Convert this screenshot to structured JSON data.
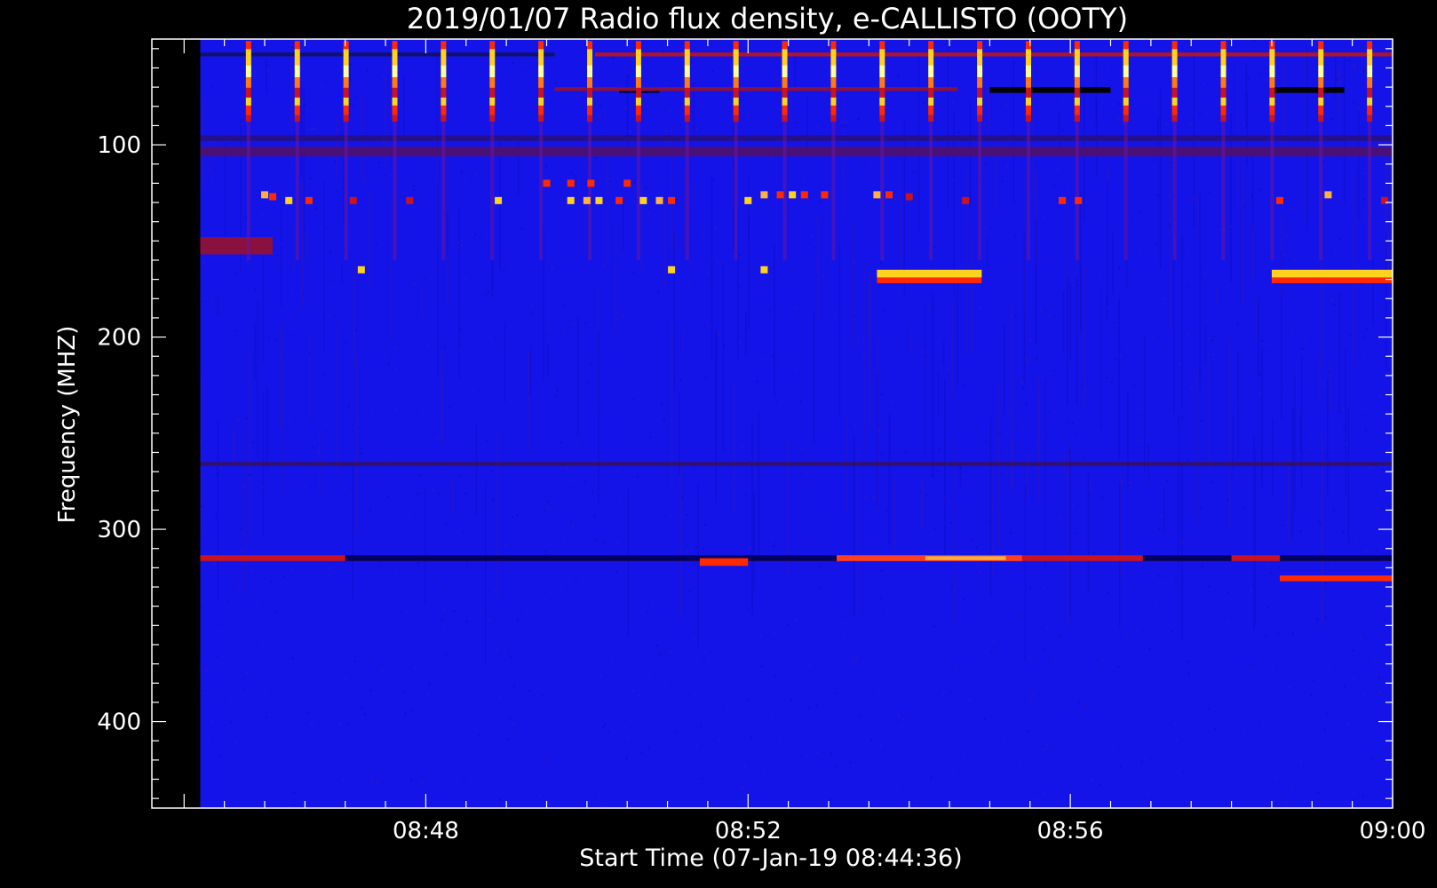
{
  "chart_data": {
    "type": "heatmap",
    "title": "2019/01/07  Radio flux density, e-CALLISTO (OOTY)",
    "xlabel": "Start Time (07-Jan-19 08:44:36)",
    "ylabel": "Frequency (MHZ)",
    "x_start": "08:44:36",
    "x_end": "09:00:00",
    "xlim_minutes": [
      0,
      15.4
    ],
    "ylim": [
      445,
      45
    ],
    "y_tick_values": [
      100,
      200,
      300,
      400
    ],
    "y_tick_labels": [
      "100",
      "200",
      "300",
      "400"
    ],
    "x_ticks": [
      {
        "label": "08:48",
        "minute": 3.4
      },
      {
        "label": "08:52",
        "minute": 7.4
      },
      {
        "label": "08:56",
        "minute": 11.4
      },
      {
        "label": "09:00",
        "minute": 15.4
      }
    ],
    "data_extent": {
      "x_minutes": [
        0.6,
        15.4
      ],
      "freq_mhz": [
        45,
        445
      ]
    },
    "colormap": [
      "#000000",
      "#1414e8",
      "#c8141e",
      "#ff2a00",
      "#ffd21e",
      "#ffff96"
    ],
    "background_color": "#1414e8",
    "periodic_bursts": {
      "start_min": 1.2,
      "period_min": 0.605,
      "count": 25,
      "freq_range": [
        46,
        88
      ]
    },
    "features": [
      {
        "kind": "band",
        "t0": 0.6,
        "t1": 15.4,
        "f0": 313.5,
        "f1": 316.5,
        "color": "#c8141e"
      },
      {
        "kind": "band",
        "t0": 2.4,
        "t1": 8.5,
        "f0": 313.5,
        "f1": 316.5,
        "color": "#000060"
      },
      {
        "kind": "band",
        "t0": 6.8,
        "t1": 7.4,
        "f0": 315,
        "f1": 319,
        "color": "#ff2a00"
      },
      {
        "kind": "band",
        "t0": 8.5,
        "t1": 10.8,
        "f0": 313.5,
        "f1": 316.5,
        "color": "#ff4020"
      },
      {
        "kind": "band",
        "t0": 9.6,
        "t1": 10.6,
        "f0": 314,
        "f1": 316,
        "color": "#ffb040"
      },
      {
        "kind": "band",
        "t0": 12.3,
        "t1": 13.4,
        "f0": 313.5,
        "f1": 316.5,
        "color": "#000060"
      },
      {
        "kind": "band",
        "t0": 14.0,
        "t1": 15.4,
        "f0": 313.5,
        "f1": 316.5,
        "color": "#000060"
      },
      {
        "kind": "band",
        "t0": 14.0,
        "t1": 15.4,
        "f0": 324,
        "f1": 327,
        "color": "#ff2a00"
      },
      {
        "kind": "band",
        "t0": 9.0,
        "t1": 10.3,
        "f0": 165,
        "f1": 169,
        "color": "#ffd21e"
      },
      {
        "kind": "band",
        "t0": 9.0,
        "t1": 10.3,
        "f0": 169,
        "f1": 172,
        "color": "#ff2a00"
      },
      {
        "kind": "band",
        "t0": 13.9,
        "t1": 15.4,
        "f0": 165,
        "f1": 169,
        "color": "#ffd21e"
      },
      {
        "kind": "band",
        "t0": 13.9,
        "t1": 15.4,
        "f0": 169,
        "f1": 172,
        "color": "#ff2a00"
      },
      {
        "kind": "band",
        "t0": 10.4,
        "t1": 11.9,
        "f0": 70,
        "f1": 73,
        "color": "#000000"
      },
      {
        "kind": "band",
        "t0": 13.9,
        "t1": 14.8,
        "f0": 70,
        "f1": 73,
        "color": "#000000"
      },
      {
        "kind": "band",
        "t0": 5.8,
        "t1": 6.3,
        "f0": 70,
        "f1": 73,
        "color": "#000030"
      },
      {
        "kind": "band",
        "t0": 5.0,
        "t1": 10.0,
        "f0": 70,
        "f1": 72,
        "color": "#8a1040"
      },
      {
        "kind": "band",
        "t0": 5.5,
        "t1": 15.4,
        "f0": 52,
        "f1": 54,
        "color": "#b01428"
      },
      {
        "kind": "band",
        "t0": 0.6,
        "t1": 5.0,
        "f0": 52,
        "f1": 54,
        "color": "#101070"
      },
      {
        "kind": "band",
        "t0": 0.6,
        "t1": 15.4,
        "f0": 95,
        "f1": 98,
        "color": "#26108a"
      },
      {
        "kind": "band",
        "t0": 0.6,
        "t1": 15.4,
        "f0": 101,
        "f1": 106,
        "color": "#4a1078"
      },
      {
        "kind": "band",
        "t0": 0.6,
        "t1": 1.5,
        "f0": 148,
        "f1": 157,
        "color": "#8a1040"
      },
      {
        "kind": "band",
        "t0": 0.6,
        "t1": 15.4,
        "f0": 265,
        "f1": 267,
        "color": "#30106a"
      }
    ],
    "dots": [
      {
        "t": 1.4,
        "f": 126,
        "color": "#ffb040"
      },
      {
        "t": 1.5,
        "f": 127,
        "color": "#ff2a00"
      },
      {
        "t": 1.7,
        "f": 129,
        "color": "#ffd21e"
      },
      {
        "t": 1.95,
        "f": 129,
        "color": "#ff2a00"
      },
      {
        "t": 2.5,
        "f": 129,
        "color": "#c8141e"
      },
      {
        "t": 3.2,
        "f": 129,
        "color": "#c8141e"
      },
      {
        "t": 4.3,
        "f": 129,
        "color": "#ffd21e"
      },
      {
        "t": 4.9,
        "f": 120,
        "color": "#ff2a00"
      },
      {
        "t": 5.2,
        "f": 120,
        "color": "#ff2a00"
      },
      {
        "t": 5.45,
        "f": 120,
        "color": "#ff2a00"
      },
      {
        "t": 5.9,
        "f": 120,
        "color": "#ff2a00"
      },
      {
        "t": 5.2,
        "f": 129,
        "color": "#ffd21e"
      },
      {
        "t": 5.4,
        "f": 129,
        "color": "#ffb040"
      },
      {
        "t": 5.55,
        "f": 129,
        "color": "#ffd21e"
      },
      {
        "t": 5.8,
        "f": 129,
        "color": "#ff2a00"
      },
      {
        "t": 6.1,
        "f": 129,
        "color": "#ffd21e"
      },
      {
        "t": 6.3,
        "f": 129,
        "color": "#ffb040"
      },
      {
        "t": 6.45,
        "f": 129,
        "color": "#ff2a00"
      },
      {
        "t": 7.4,
        "f": 129,
        "color": "#ffd21e"
      },
      {
        "t": 7.6,
        "f": 126,
        "color": "#ffb040"
      },
      {
        "t": 7.8,
        "f": 126,
        "color": "#ff2a00"
      },
      {
        "t": 7.95,
        "f": 126,
        "color": "#ffd21e"
      },
      {
        "t": 8.1,
        "f": 126,
        "color": "#ff2a00"
      },
      {
        "t": 8.35,
        "f": 126,
        "color": "#ff2a00"
      },
      {
        "t": 9.0,
        "f": 126,
        "color": "#ffb040"
      },
      {
        "t": 9.15,
        "f": 126,
        "color": "#ff2a00"
      },
      {
        "t": 9.4,
        "f": 127,
        "color": "#c8141e"
      },
      {
        "t": 10.1,
        "f": 129,
        "color": "#c8141e"
      },
      {
        "t": 11.3,
        "f": 129,
        "color": "#ff2a00"
      },
      {
        "t": 11.5,
        "f": 129,
        "color": "#ff2a00"
      },
      {
        "t": 14.0,
        "f": 129,
        "color": "#ff2a00"
      },
      {
        "t": 14.6,
        "f": 126,
        "color": "#ffb040"
      },
      {
        "t": 15.3,
        "f": 129,
        "color": "#c8141e"
      },
      {
        "t": 2.6,
        "f": 165,
        "color": "#ffd21e"
      },
      {
        "t": 6.45,
        "f": 165,
        "color": "#ffd21e"
      },
      {
        "t": 7.6,
        "f": 165,
        "color": "#ffd21e"
      }
    ],
    "grid": false,
    "legend": "none"
  }
}
